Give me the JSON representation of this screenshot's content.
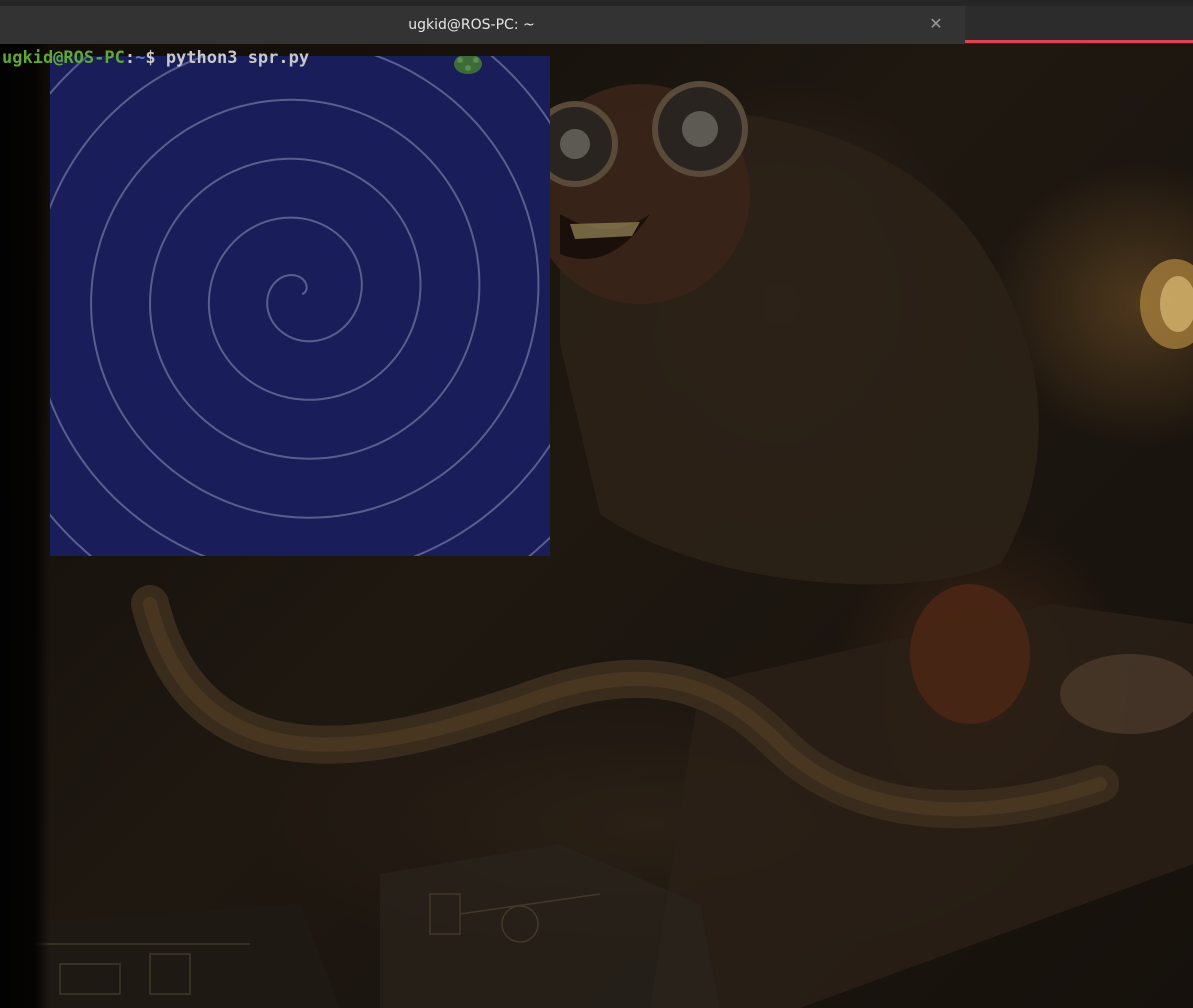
{
  "window": {
    "title": "ugkid@ROS-PC: ~",
    "close_icon": "close-icon",
    "accent_color": "#e0434f"
  },
  "terminal": {
    "user_host": "ugkid@ROS-PC",
    "separator": ":",
    "path": "~",
    "prompt_symbol": "$ ",
    "command": "python3 spr.py",
    "colors": {
      "user_host": "#5fa834",
      "path": "#5b7fb9",
      "text": "#c8c8c8"
    }
  },
  "turtle_canvas": {
    "background": "#191d5a",
    "line_color": "#4a4e7a",
    "drawing": "spiral"
  },
  "wallpaper": {
    "description_icon": "steampunk-wallpaper-image"
  }
}
